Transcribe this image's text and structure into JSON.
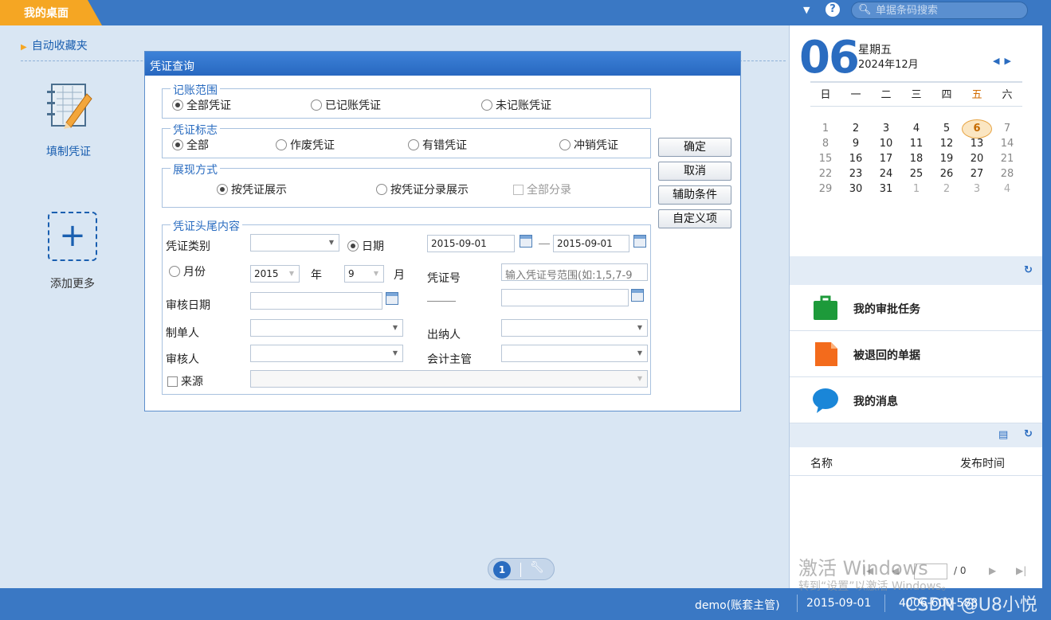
{
  "topbar": {
    "tab_label": "我的桌面",
    "search_placeholder": "单据条码搜索"
  },
  "desktop": {
    "favorites_title": "自动收藏夹",
    "apps": [
      {
        "label": "填制凭证",
        "icon": "notebook-pencil-icon"
      },
      {
        "label": "添加更多",
        "icon": "add-more-icon"
      }
    ]
  },
  "dialog": {
    "title": "凭证查询",
    "range": {
      "legend": "记账范围",
      "options": [
        "全部凭证",
        "已记账凭证",
        "未记账凭证"
      ],
      "selected": 0
    },
    "flag": {
      "legend": "凭证标志",
      "options": [
        "全部",
        "作废凭证",
        "有错凭证",
        "冲销凭证"
      ],
      "selected": 0
    },
    "display": {
      "legend": "展现方式",
      "options": [
        "按凭证展示",
        "按凭证分录展示"
      ],
      "selected": 0,
      "all_entries": "全部分录"
    },
    "header": {
      "legend": "凭证头尾内容",
      "type_label": "凭证类别",
      "date_label": "日期",
      "date_from": "2015-09-01",
      "date_to": "2015-09-01",
      "month_label": "月份",
      "year_value": "2015",
      "year_unit": "年",
      "month_value": "9",
      "month_unit": "月",
      "voucher_no_label": "凭证号",
      "voucher_no_placeholder": "输入凭证号范围(如:1,5,7-9",
      "audit_date_label": "审核日期",
      "maker_label": "制单人",
      "cashier_label": "出纳人",
      "auditor_label": "审核人",
      "supervisor_label": "会计主管",
      "source_label": "来源"
    },
    "buttons": {
      "ok": "确定",
      "cancel": "取消",
      "aux": "辅助条件",
      "custom": "自定义项"
    }
  },
  "pager": {
    "page": "1"
  },
  "status": {
    "user": "demo(账套主管)",
    "date": "2015-09-01",
    "phone": "4006-600-588"
  },
  "calendar": {
    "day": "06",
    "weekday": "星期五",
    "month": "2024年12月",
    "headers": [
      "日",
      "一",
      "二",
      "三",
      "四",
      "五",
      "六"
    ],
    "weeks": [
      [
        "1",
        "2",
        "3",
        "4",
        "5",
        "6",
        "7"
      ],
      [
        "8",
        "9",
        "10",
        "11",
        "12",
        "13",
        "14"
      ],
      [
        "15",
        "16",
        "17",
        "18",
        "19",
        "20",
        "21"
      ],
      [
        "22",
        "23",
        "24",
        "25",
        "26",
        "27",
        "28"
      ],
      [
        "29",
        "30",
        "31",
        "1",
        "2",
        "3",
        "4"
      ]
    ]
  },
  "tasks": [
    {
      "label": "我的审批任务",
      "icon": "briefcase-icon",
      "color": "#1d9a3a"
    },
    {
      "label": "被退回的单据",
      "icon": "document-icon",
      "color": "#f36b1c"
    },
    {
      "label": "我的消息",
      "icon": "chat-bubble-icon",
      "color": "#1a86d8"
    }
  ],
  "news": {
    "col_name": "名称",
    "col_time": "发布时间",
    "total": "/ 0"
  },
  "watermark": {
    "line1": "激活 Windows",
    "line2": "转到“设置”以激活 Windows。",
    "credit": "CSDN @U8小悦"
  }
}
